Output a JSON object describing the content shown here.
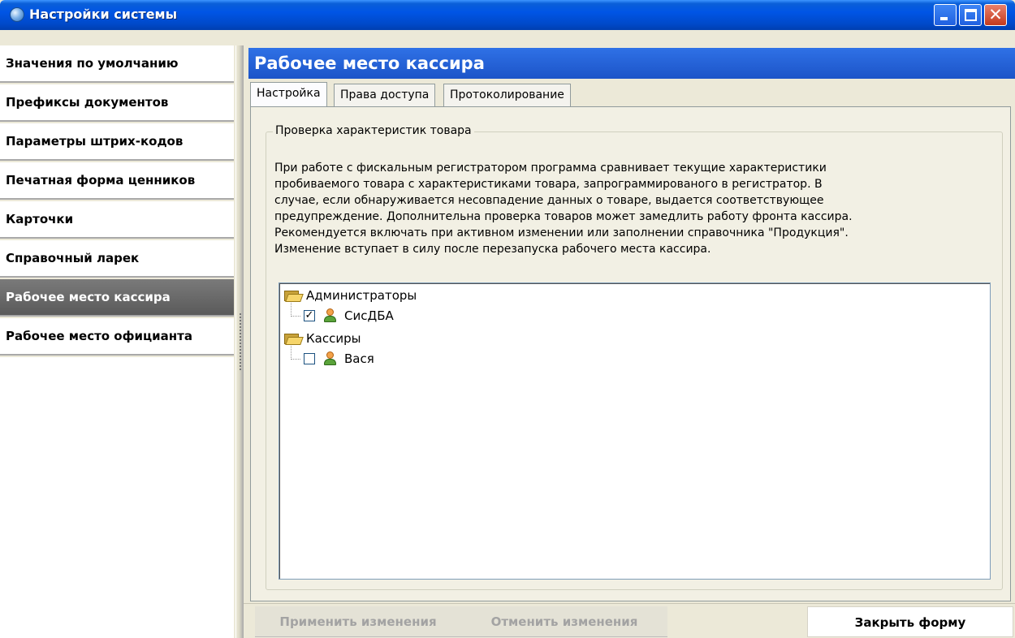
{
  "window": {
    "title": "Настройки системы",
    "icon": "globe-icon"
  },
  "sidebar": {
    "items": [
      {
        "label": "Значения по умолчанию",
        "active": false
      },
      {
        "label": "Префиксы документов",
        "active": false
      },
      {
        "label": "Параметры штрих-кодов",
        "active": false
      },
      {
        "label": "Печатная форма ценников",
        "active": false
      },
      {
        "label": "Карточки",
        "active": false
      },
      {
        "label": "Справочный ларек",
        "active": false
      },
      {
        "label": "Рабочее место кассира",
        "active": true
      },
      {
        "label": "Рабочее место официанта",
        "active": false
      }
    ]
  },
  "main": {
    "header": "Рабочее место кассира",
    "tabs": [
      {
        "label": "Настройка",
        "active": true
      },
      {
        "label": "Права доступа",
        "active": false
      },
      {
        "label": "Протоколирование",
        "active": false
      }
    ],
    "group": {
      "title": "Проверка характеристик товара",
      "description_lines": [
        "При работе с фискальным регистратором программа сравнивает текущие характеристики",
        "пробиваемого товара с характеристиками товара, запрограммированого в регистратор. В",
        "случае, если обнаруживается несовпадение данных о товаре, выдается соответствующее",
        "предупреждение. Дополнительна проверка товаров может замедлить работу фронта кассира.",
        "Рекомендуется включать при активном изменении или заполнении справочника \"Продукция\".",
        "Изменение вступает в силу после перезапуска рабочего места кассира."
      ]
    },
    "tree": {
      "groups": [
        {
          "label": "Администраторы",
          "icon": "folder-open-icon",
          "users": [
            {
              "label": "СисДБА",
              "checked": true,
              "icon": "user-icon"
            }
          ]
        },
        {
          "label": "Кассиры",
          "icon": "folder-open-icon",
          "users": [
            {
              "label": "Вася",
              "checked": false,
              "icon": "user-icon"
            }
          ]
        }
      ]
    }
  },
  "footer": {
    "apply_label": "Применить изменения",
    "cancel_label": "Отменить изменения",
    "close_label": "Закрыть форму"
  }
}
